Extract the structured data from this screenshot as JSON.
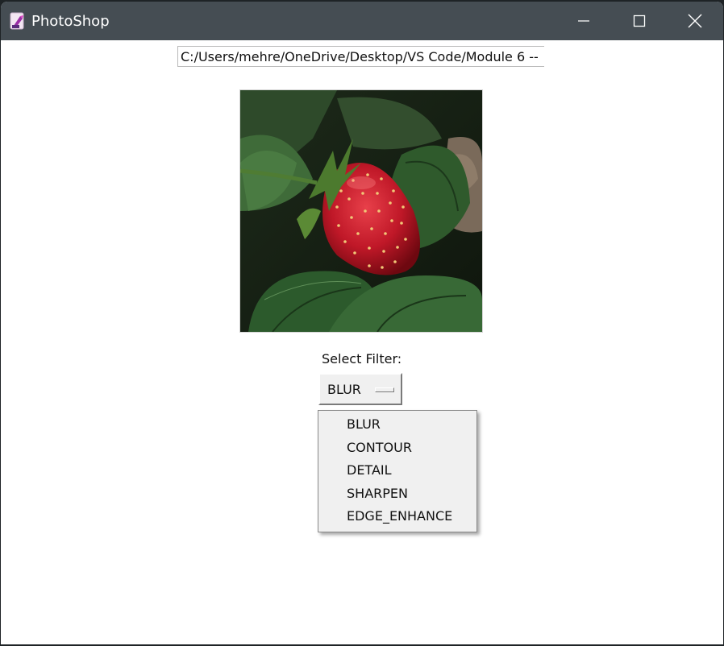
{
  "window": {
    "title": "PhotoShop",
    "icon": "app-logo-icon",
    "controls": [
      "minimize-icon",
      "maximize-icon",
      "close-icon"
    ]
  },
  "file_path": {
    "value": "C:/Users/mehre/OneDrive/Desktop/VS Code/Module 6 --"
  },
  "preview": {
    "description_icon": "strawberry-image"
  },
  "filter": {
    "label": "Select Filter:",
    "selected": "BLUR",
    "options": [
      "BLUR",
      "CONTOUR",
      "DETAIL",
      "SHARPEN",
      "EDGE_ENHANCE"
    ]
  },
  "colors": {
    "titlebar": "#454d53",
    "window_bg": "#ffffff",
    "menu_bg": "#f0f0f0"
  }
}
